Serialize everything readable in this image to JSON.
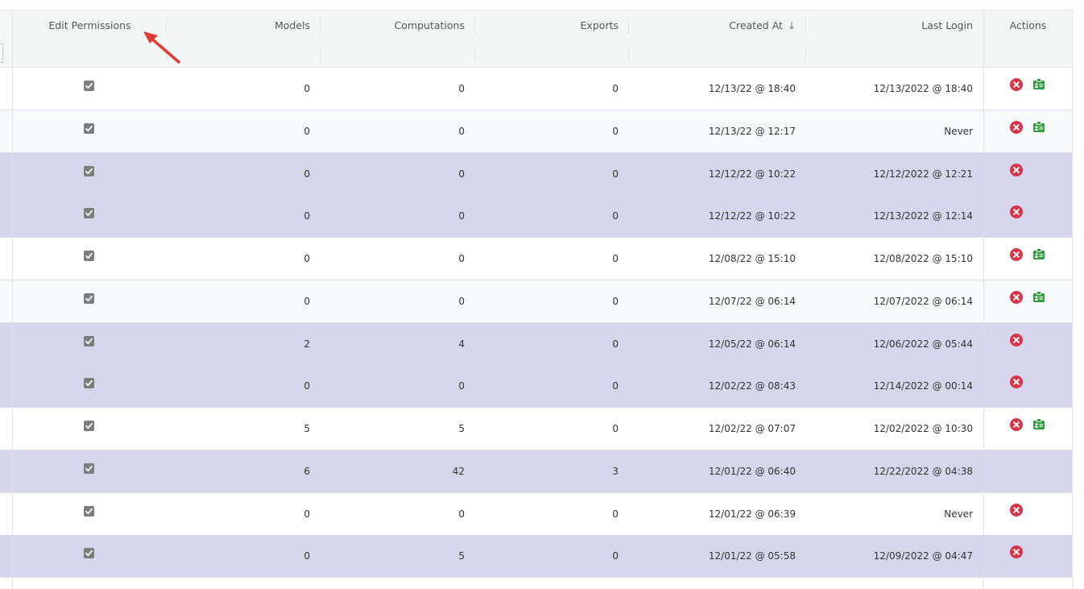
{
  "columns": {
    "edit_permissions": "Edit Permissions",
    "models": "Models",
    "computations": "Computations",
    "exports": "Exports",
    "created_at": "Created At",
    "created_at_sort": "↓",
    "last_login": "Last Login",
    "actions": "Actions"
  },
  "colors": {
    "row_white": "#ffffff",
    "row_alt": "#f8fafc",
    "row_selected": "#d8d6ec",
    "delete": "#d8344a",
    "badge": "#2e9e3e",
    "arrow": "#e23b34"
  },
  "rows": [
    {
      "edit_permissions": true,
      "models": "0",
      "computations": "0",
      "exports": "0",
      "created_at": "12/13/22 @ 18:40",
      "last_login": "12/13/2022 @ 18:40",
      "bg": "white",
      "delete": true,
      "badge": true
    },
    {
      "edit_permissions": true,
      "models": "0",
      "computations": "0",
      "exports": "0",
      "created_at": "12/13/22 @ 12:17",
      "last_login": "Never",
      "bg": "alt",
      "delete": true,
      "badge": true
    },
    {
      "edit_permissions": true,
      "models": "0",
      "computations": "0",
      "exports": "0",
      "created_at": "12/12/22 @ 10:22",
      "last_login": "12/12/2022 @ 12:21",
      "bg": "selected",
      "delete": true,
      "badge": false
    },
    {
      "edit_permissions": true,
      "models": "0",
      "computations": "0",
      "exports": "0",
      "created_at": "12/12/22 @ 10:22",
      "last_login": "12/13/2022 @ 12:14",
      "bg": "selected",
      "delete": true,
      "badge": false
    },
    {
      "edit_permissions": true,
      "models": "0",
      "computations": "0",
      "exports": "0",
      "created_at": "12/08/22 @ 15:10",
      "last_login": "12/08/2022 @ 15:10",
      "bg": "white",
      "delete": true,
      "badge": true
    },
    {
      "edit_permissions": true,
      "models": "0",
      "computations": "0",
      "exports": "0",
      "created_at": "12/07/22 @ 06:14",
      "last_login": "12/07/2022 @ 06:14",
      "bg": "alt",
      "delete": true,
      "badge": true
    },
    {
      "edit_permissions": true,
      "models": "2",
      "computations": "4",
      "exports": "0",
      "created_at": "12/05/22 @ 06:14",
      "last_login": "12/06/2022 @ 05:44",
      "bg": "selected",
      "delete": true,
      "badge": false
    },
    {
      "edit_permissions": true,
      "models": "0",
      "computations": "0",
      "exports": "0",
      "created_at": "12/02/22 @ 08:43",
      "last_login": "12/14/2022 @ 00:14",
      "bg": "selected",
      "delete": true,
      "badge": false
    },
    {
      "edit_permissions": true,
      "models": "5",
      "computations": "5",
      "exports": "0",
      "created_at": "12/02/22 @ 07:07",
      "last_login": "12/02/2022 @ 10:30",
      "bg": "white",
      "delete": true,
      "badge": true
    },
    {
      "edit_permissions": true,
      "models": "6",
      "computations": "42",
      "exports": "3",
      "created_at": "12/01/22 @ 06:40",
      "last_login": "12/22/2022 @ 04:38",
      "bg": "selected",
      "delete": false,
      "badge": false
    },
    {
      "edit_permissions": true,
      "models": "0",
      "computations": "0",
      "exports": "0",
      "created_at": "12/01/22 @ 06:39",
      "last_login": "Never",
      "bg": "white",
      "delete": true,
      "badge": false
    },
    {
      "edit_permissions": true,
      "models": "0",
      "computations": "5",
      "exports": "0",
      "created_at": "12/01/22 @ 05:58",
      "last_login": "12/09/2022 @ 04:47",
      "bg": "selected",
      "delete": true,
      "badge": false
    }
  ]
}
